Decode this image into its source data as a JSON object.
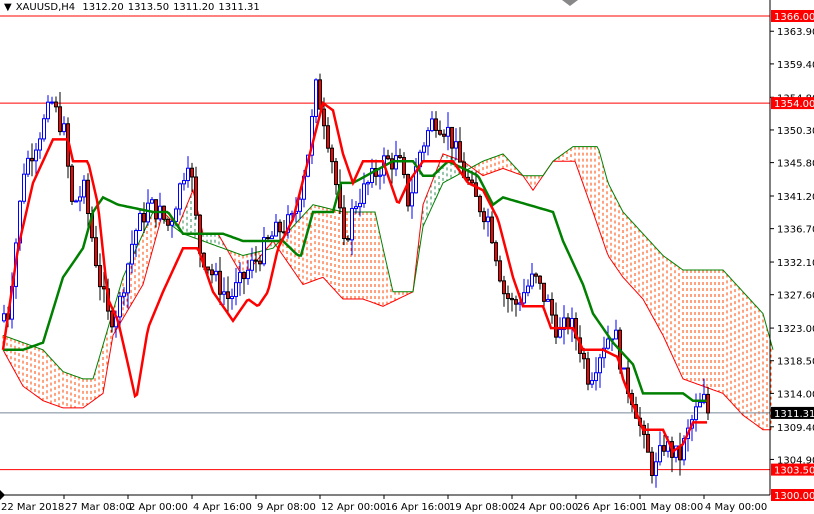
{
  "header": {
    "symbol": "XAUUSD,H4",
    "open": "1312.20",
    "high": "1313.50",
    "low": "1311.20",
    "close": "1311.31"
  },
  "chart_data": {
    "type": "candlestick",
    "title": "XAUUSD,H4",
    "bars_visible": 177,
    "ylim": [
      1300,
      1366
    ],
    "y_ticks": [
      "1363.90",
      "1359.40",
      "1354.80",
      "1350.30",
      "1345.80",
      "1341.20",
      "1336.70",
      "1332.10",
      "1327.60",
      "1323.00",
      "1318.50",
      "1314.00",
      "1309.40",
      "1304.90"
    ],
    "x_ticks": [
      "22 Mar 2018",
      "27 Mar 08:00",
      "2 Apr 00:00",
      "4 Apr 16:00",
      "9 Apr 08:00",
      "12 Apr 00:00",
      "16 Apr 16:00",
      "19 Apr 08:00",
      "24 Apr 00:00",
      "26 Apr 16:00",
      "1 May 08:00",
      "4 May 00:00"
    ],
    "x_tick_every_bars": 16,
    "price_levels": [
      {
        "label": "1366.00",
        "value": 1366.0,
        "color": "#ff0000"
      },
      {
        "label": "1354.00",
        "value": 1354.0,
        "color": "#ff0000"
      },
      {
        "label": "1303.50",
        "value": 1303.5,
        "color": "#ff0000"
      },
      {
        "label": "1300.00",
        "value": 1300.0,
        "color": "#ff0000"
      }
    ],
    "current_price": {
      "label": "1311.31",
      "value": 1311.31,
      "color": "#778899"
    },
    "colors": {
      "bull": "#0000ff",
      "bear_body": "#ff0000",
      "bear_outline": "#000000",
      "tenkan": "#ff0000",
      "kijun": "#008000",
      "span_a": "#ff0000",
      "span_b": "#008000",
      "cloud_bear": "#ff4500",
      "cloud_bull": "#2e8b57"
    },
    "close_path": [
      [
        1,
        1325
      ],
      [
        5,
        1345
      ],
      [
        7.5,
        1348
      ],
      [
        12,
        1354
      ],
      [
        15,
        1350
      ],
      [
        17,
        1340
      ],
      [
        20,
        1342
      ],
      [
        23.75,
        1330
      ],
      [
        26.25,
        1324
      ],
      [
        28.75,
        1326
      ],
      [
        32.5,
        1336
      ],
      [
        36.25,
        1340
      ],
      [
        38.75,
        1339
      ],
      [
        41.25,
        1337
      ],
      [
        46.25,
        1347
      ],
      [
        48.75,
        1334
      ],
      [
        52.5,
        1330
      ],
      [
        56.25,
        1327
      ],
      [
        58.75,
        1329
      ],
      [
        62.5,
        1332
      ],
      [
        67.5,
        1336
      ],
      [
        72.5,
        1338
      ],
      [
        76.25,
        1348
      ],
      [
        78,
        1356
      ],
      [
        80,
        1352
      ],
      [
        82.5,
        1345
      ],
      [
        85,
        1334
      ],
      [
        87.5,
        1340
      ],
      [
        91.25,
        1343
      ],
      [
        95,
        1346
      ],
      [
        98.75,
        1346
      ],
      [
        101.25,
        1340
      ],
      [
        103.75,
        1347
      ],
      [
        107.5,
        1352
      ],
      [
        111.25,
        1350
      ],
      [
        113.75,
        1346
      ],
      [
        117.5,
        1341
      ],
      [
        121.25,
        1338
      ],
      [
        125,
        1328
      ],
      [
        127.5,
        1326
      ],
      [
        132.5,
        1330
      ],
      [
        136.25,
        1326
      ],
      [
        138.75,
        1322
      ],
      [
        141.25,
        1324
      ],
      [
        143.75,
        1321
      ],
      [
        146.25,
        1316
      ],
      [
        150,
        1321
      ],
      [
        152.5,
        1323
      ],
      [
        155,
        1316
      ],
      [
        157.5,
        1313
      ],
      [
        160,
        1307
      ],
      [
        162.5,
        1303
      ],
      [
        165,
        1307
      ],
      [
        168.75,
        1305
      ],
      [
        172.5,
        1311
      ],
      [
        175,
        1313
      ],
      [
        176.25,
        1311.31
      ]
    ],
    "tenkan": [
      [
        0,
        1320
      ],
      [
        3.75,
        1334
      ],
      [
        7.5,
        1343
      ],
      [
        12.5,
        1349
      ],
      [
        16.25,
        1349
      ],
      [
        17.5,
        1346
      ],
      [
        21.25,
        1346
      ],
      [
        23.75,
        1340
      ],
      [
        26.25,
        1327
      ],
      [
        28.75,
        1324
      ],
      [
        31.25,
        1318
      ],
      [
        33.25,
        1313
      ],
      [
        36.25,
        1323
      ],
      [
        40,
        1328
      ],
      [
        42.5,
        1331
      ],
      [
        45,
        1334
      ],
      [
        48.75,
        1334
      ],
      [
        52.5,
        1328
      ],
      [
        57.5,
        1324
      ],
      [
        61.25,
        1327
      ],
      [
        63.75,
        1326
      ],
      [
        66.25,
        1328
      ],
      [
        68.75,
        1334
      ],
      [
        72.5,
        1338
      ],
      [
        76.25,
        1346
      ],
      [
        80,
        1354
      ],
      [
        82.5,
        1353
      ],
      [
        85,
        1347
      ],
      [
        87.5,
        1343
      ],
      [
        90,
        1346
      ],
      [
        95,
        1346
      ],
      [
        98.75,
        1340
      ],
      [
        101.25,
        1343
      ],
      [
        105,
        1346
      ],
      [
        112.5,
        1346
      ],
      [
        116.25,
        1343
      ],
      [
        120,
        1342
      ],
      [
        123.75,
        1338
      ],
      [
        127.5,
        1330
      ],
      [
        130,
        1326
      ],
      [
        135,
        1326
      ],
      [
        137,
        1323
      ],
      [
        142.5,
        1323
      ],
      [
        145,
        1320
      ],
      [
        150,
        1320
      ],
      [
        153.75,
        1319
      ],
      [
        155,
        1316
      ],
      [
        160,
        1309
      ],
      [
        165,
        1309
      ],
      [
        167.5,
        1306
      ],
      [
        170,
        1307
      ],
      [
        172.5,
        1310
      ],
      [
        176.25,
        1310
      ]
    ],
    "kijun": [
      [
        0,
        1320
      ],
      [
        5,
        1320
      ],
      [
        10,
        1321
      ],
      [
        15,
        1330
      ],
      [
        20,
        1334
      ],
      [
        22.5,
        1339
      ],
      [
        25,
        1341
      ],
      [
        28.75,
        1340
      ],
      [
        37.5,
        1339
      ],
      [
        41.25,
        1339
      ],
      [
        43.75,
        1337
      ],
      [
        45,
        1336
      ],
      [
        55,
        1336
      ],
      [
        60,
        1335
      ],
      [
        70,
        1335
      ],
      [
        73.75,
        1333
      ],
      [
        74.5,
        1333
      ],
      [
        77.5,
        1339
      ],
      [
        82.5,
        1339
      ],
      [
        84.5,
        1343
      ],
      [
        87.5,
        1343
      ],
      [
        97.5,
        1346
      ],
      [
        102.5,
        1346
      ],
      [
        105,
        1344
      ],
      [
        107.5,
        1344
      ],
      [
        111.25,
        1346
      ],
      [
        118.75,
        1344
      ],
      [
        122.5,
        1340
      ],
      [
        125,
        1341
      ],
      [
        137.5,
        1339
      ],
      [
        140,
        1335
      ],
      [
        142.5,
        1332
      ],
      [
        145,
        1329
      ],
      [
        147.5,
        1325
      ],
      [
        150,
        1323
      ],
      [
        152.5,
        1321
      ],
      [
        157.5,
        1318
      ],
      [
        160,
        1314
      ],
      [
        170,
        1314
      ],
      [
        172.5,
        1313
      ],
      [
        176.25,
        1313
      ]
    ],
    "span_a": [
      [
        0,
        1320
      ],
      [
        5,
        1315
      ],
      [
        10,
        1313
      ],
      [
        15,
        1312
      ],
      [
        20,
        1312
      ],
      [
        25,
        1314
      ],
      [
        27.5,
        1322
      ],
      [
        35,
        1329
      ],
      [
        40,
        1339
      ],
      [
        43.75,
        1337
      ],
      [
        47.5,
        1342
      ],
      [
        50,
        1336
      ],
      [
        53.75,
        1336
      ],
      [
        60,
        1330
      ],
      [
        67.5,
        1335
      ],
      [
        72.5,
        1331
      ],
      [
        75,
        1329
      ],
      [
        80,
        1330
      ],
      [
        85,
        1327
      ],
      [
        90,
        1327
      ],
      [
        95,
        1326
      ],
      [
        102.5,
        1328
      ],
      [
        105,
        1340
      ],
      [
        110,
        1347
      ],
      [
        115,
        1346
      ],
      [
        120,
        1344
      ],
      [
        125,
        1345
      ],
      [
        130,
        1344
      ],
      [
        132.5,
        1342
      ],
      [
        135,
        1344
      ],
      [
        137.5,
        1346
      ],
      [
        143,
        1346
      ],
      [
        147.5,
        1339
      ],
      [
        151.25,
        1333
      ],
      [
        155,
        1330
      ],
      [
        160,
        1327
      ],
      [
        165,
        1322
      ],
      [
        170,
        1316
      ],
      [
        175,
        1315
      ],
      [
        180,
        1314
      ],
      [
        185,
        1311
      ],
      [
        190,
        1309
      ],
      [
        192,
        1309
      ]
    ],
    "span_b": [
      [
        0,
        1322
      ],
      [
        5,
        1321
      ],
      [
        10,
        1320
      ],
      [
        15,
        1317
      ],
      [
        20,
        1316
      ],
      [
        22.5,
        1316
      ],
      [
        30,
        1330
      ],
      [
        37.5,
        1339
      ],
      [
        45,
        1336
      ],
      [
        60,
        1333
      ],
      [
        67.5,
        1334
      ],
      [
        77.5,
        1340
      ],
      [
        85,
        1339
      ],
      [
        93,
        1339
      ],
      [
        95,
        1334
      ],
      [
        97.5,
        1328
      ],
      [
        102.5,
        1328
      ],
      [
        105,
        1337
      ],
      [
        110,
        1343
      ],
      [
        120,
        1346
      ],
      [
        125,
        1347
      ],
      [
        130,
        1344
      ],
      [
        135,
        1344
      ],
      [
        137.5,
        1346
      ],
      [
        142.5,
        1348
      ],
      [
        148.75,
        1348
      ],
      [
        151.25,
        1343
      ],
      [
        155,
        1339
      ],
      [
        160,
        1336
      ],
      [
        165,
        1333
      ],
      [
        170,
        1331
      ],
      [
        180,
        1331
      ],
      [
        185,
        1328
      ],
      [
        190,
        1325
      ],
      [
        192.5,
        1320
      ]
    ]
  }
}
